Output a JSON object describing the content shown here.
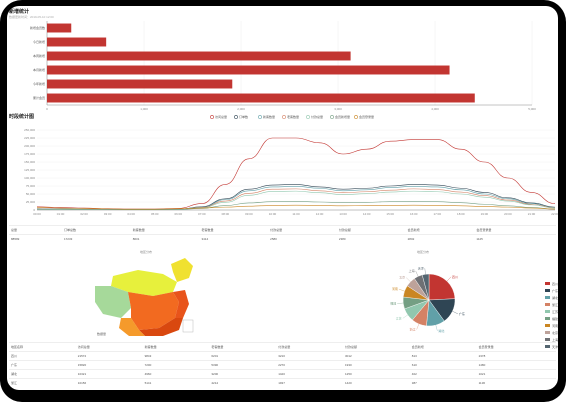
{
  "header": {
    "title": "新增统计",
    "subtitle": "数据更新时间：2019-05-10 12:00"
  },
  "line_section": {
    "title": "时段统计图"
  },
  "bar_chart": {
    "categories": [
      "新增会员数",
      "今日新增",
      "本周新增",
      "本月新增",
      "今年新增",
      "累计会员"
    ],
    "values": [
      250,
      610,
      3130,
      4150,
      1910,
      4410
    ],
    "xlim": [
      0,
      5000
    ],
    "x_ticks": [
      "0",
      "1,000",
      "2,000",
      "3,000",
      "4,000",
      "5,000"
    ],
    "color": "#c23531"
  },
  "line_chart": {
    "legend": [
      "访问总量",
      "订单数",
      "新客数量",
      "老客数量",
      "付款总量",
      "会员新增量",
      "会员登录量"
    ],
    "colors": [
      "#c23531",
      "#2f4554",
      "#61a0a8",
      "#d48265",
      "#91c7ae",
      "#749f83",
      "#ca8622"
    ],
    "y_ticks": [
      "250,000",
      "225,000",
      "200,000",
      "175,000",
      "150,000",
      "125,000",
      "100,000",
      "75,000",
      "50,000",
      "25,000",
      "0"
    ],
    "x_ticks": [
      "00:00",
      "01:00",
      "02:00",
      "03:00",
      "04:00",
      "05:00",
      "06:00",
      "07:00",
      "08:00",
      "09:00",
      "10:00",
      "11:00",
      "12:00",
      "13:00",
      "14:00",
      "15:00",
      "16:00",
      "17:00",
      "18:00",
      "19:00",
      "20:00",
      "21:00",
      "22:00"
    ],
    "series": [
      {
        "name": "访问总量",
        "values": [
          10000,
          8000,
          6000,
          4000,
          3000,
          3000,
          5000,
          20000,
          80000,
          160000,
          225000,
          225000,
          210000,
          175000,
          190000,
          215000,
          220000,
          220000,
          190000,
          150000,
          100000,
          55000,
          20000
        ]
      },
      {
        "name": "订单数",
        "values": [
          4000,
          3000,
          2500,
          2000,
          1500,
          1500,
          2500,
          10000,
          35000,
          65000,
          78000,
          80000,
          72000,
          65000,
          68000,
          75000,
          80000,
          78000,
          68000,
          55000,
          38000,
          22000,
          9000
        ]
      },
      {
        "name": "新客数量",
        "values": [
          3500,
          2800,
          2300,
          1800,
          1300,
          1300,
          2300,
          9000,
          32000,
          60000,
          72000,
          74000,
          68000,
          60000,
          63000,
          70000,
          74000,
          72000,
          63000,
          50000,
          35000,
          20000,
          8000
        ]
      },
      {
        "name": "老客数量",
        "values": [
          3000,
          2500,
          2000,
          1600,
          1200,
          1200,
          2000,
          8000,
          28000,
          52000,
          65000,
          66000,
          60000,
          54000,
          57000,
          62000,
          66000,
          64000,
          56000,
          45000,
          31000,
          18000,
          7000
        ]
      },
      {
        "name": "付款总量",
        "values": [
          2500,
          2000,
          1700,
          1300,
          1000,
          1000,
          1700,
          7000,
          24000,
          46000,
          58000,
          59000,
          54000,
          48000,
          51000,
          56000,
          59000,
          57000,
          50000,
          40000,
          28000,
          16000,
          6000
        ]
      },
      {
        "name": "会员新增量",
        "values": [
          2000,
          1600,
          1300,
          1000,
          800,
          800,
          1400,
          5000,
          14000,
          22000,
          26000,
          27000,
          25000,
          23000,
          24000,
          26000,
          27000,
          26000,
          23000,
          18000,
          13000,
          8000,
          3000
        ]
      },
      {
        "name": "会员登录量",
        "values": [
          8000,
          6000,
          5000,
          3500,
          2500,
          2500,
          4000,
          6000,
          9000,
          12000,
          14000,
          15000,
          14000,
          13000,
          13500,
          14000,
          15000,
          14500,
          13000,
          11000,
          9000,
          6000,
          3000
        ]
      }
    ]
  },
  "summary_table": {
    "headers": [
      "总量",
      "订单总数",
      "新客数量",
      "老客数量",
      "付款总量",
      "付款总额",
      "会员新增",
      "会员登录量"
    ],
    "values": [
      "88599",
      "17233",
      "8631",
      "3414",
      "2580",
      "2380",
      "2802",
      "1125"
    ]
  },
  "map": {
    "title": "地区分布",
    "legend_label": "数据量"
  },
  "pie": {
    "title": "地区分布",
    "labels": [
      "四川",
      "广东",
      "湖北",
      "浙江",
      "江苏",
      "福建",
      "河南",
      "北京",
      "上海",
      "天津"
    ],
    "values": [
      23,
      15,
      11,
      9,
      8,
      7,
      7,
      6,
      5,
      4
    ],
    "colors": [
      "#c23531",
      "#2f4554",
      "#61a0a8",
      "#d48265",
      "#91c7ae",
      "#749f83",
      "#ca8622",
      "#bda29a",
      "#6e7074",
      "#546570"
    ]
  },
  "region_table": {
    "headers": [
      "地区名称",
      "访问总量",
      "新客数量",
      "老客数量",
      "付款总量",
      "付款总额",
      "会员新增",
      "会员登录量"
    ],
    "rows": [
      [
        "四川",
        "21572",
        "9843",
        "6201",
        "3210",
        "3012",
        "813",
        "2378"
      ],
      [
        "广东",
        "15820",
        "7200",
        "5390",
        "2270",
        "1930",
        "610",
        "1480"
      ],
      [
        "湖北",
        "10321",
        "4960",
        "3200",
        "1420",
        "1250",
        "402",
        "1021"
      ],
      [
        "浙江",
        "10156",
        "5141",
        "4214",
        "1937",
        "1420",
        "387",
        "1136"
      ]
    ]
  }
}
